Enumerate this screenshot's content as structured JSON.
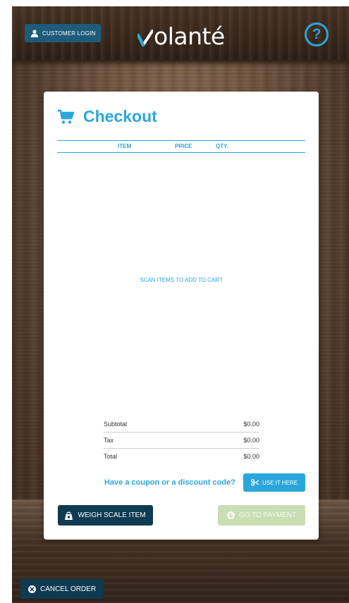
{
  "header": {
    "login_label": "CUSTOMER LOGIN",
    "logo_text": "olanté",
    "help_label": "?"
  },
  "checkout": {
    "title": "Checkout",
    "columns": [
      "ITEM",
      "PRICE",
      "QTY."
    ],
    "empty_message": "SCAN ITEMS TO ADD TO CART",
    "totals": [
      {
        "label": "Subtotal",
        "value": "$0.00"
      },
      {
        "label": "Tax",
        "value": "$0.00"
      },
      {
        "label": "Total",
        "value": "$0.00"
      }
    ],
    "coupon_question": "Have a coupon or a discount code?",
    "use_label": "USE IT HERE",
    "weigh_label": "WEIGH SCALE ITEM",
    "payment_label": "GO TO PAYMENT"
  },
  "footer": {
    "cancel_label": "CANCEL ORDER"
  },
  "icons": {
    "user": "user-icon",
    "cart": "cart-icon",
    "help": "question-mark-icon",
    "scissors": "scissors-icon",
    "weight": "weight-icon",
    "dollar": "dollar-icon",
    "cancel": "cancel-icon"
  },
  "colors": {
    "accent": "#2aa6dc",
    "dark_button": "#0e3a52",
    "login_button": "#1e5a7a",
    "payment_disabled": "#c9deb3"
  }
}
